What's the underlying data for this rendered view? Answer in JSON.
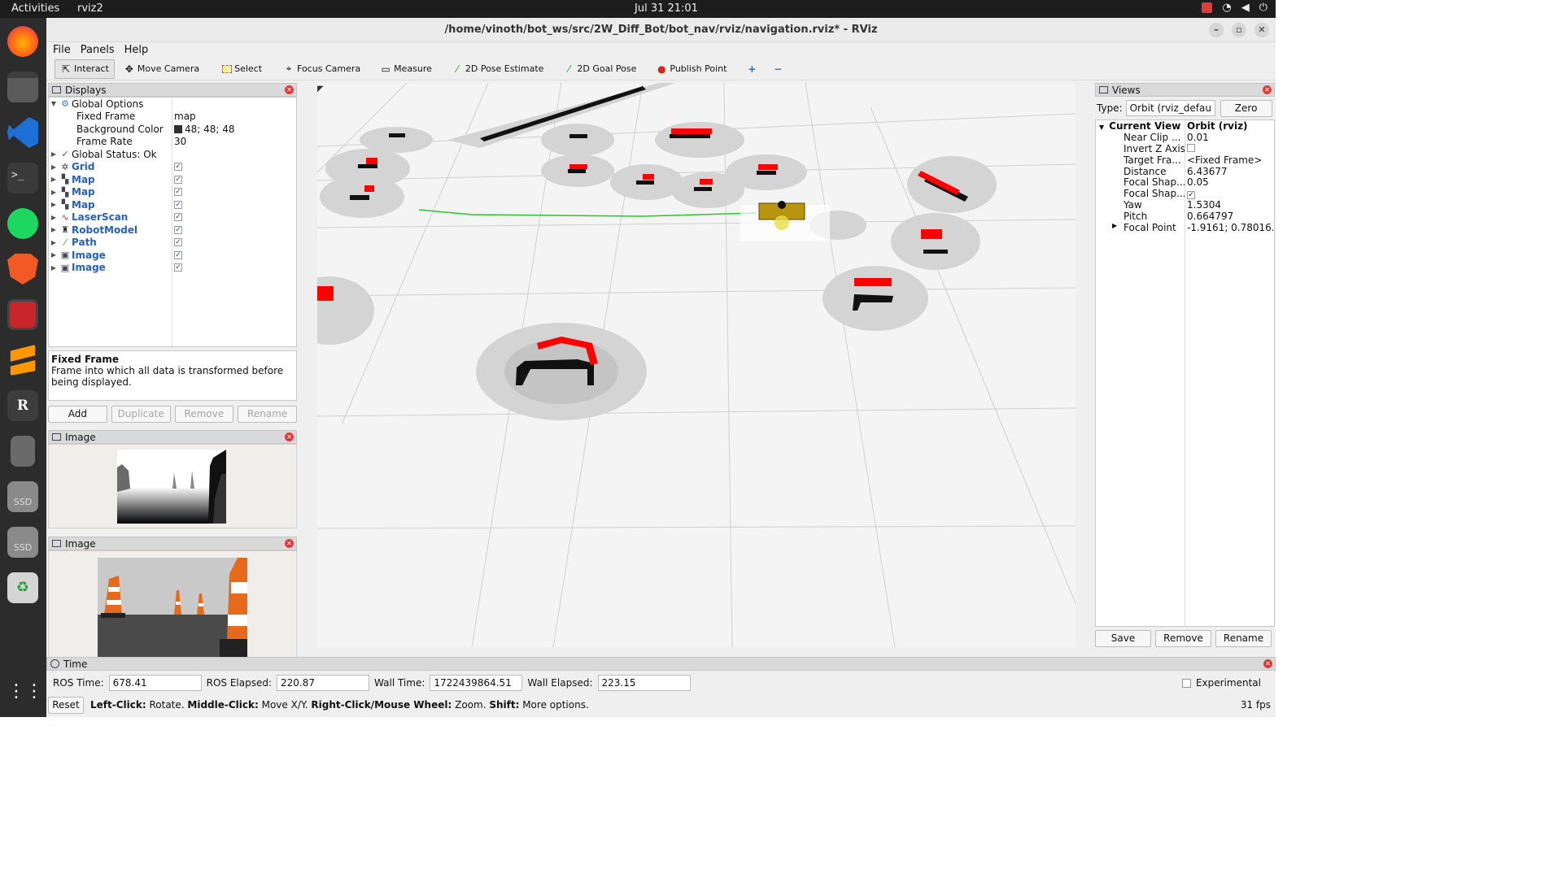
{
  "topbar": {
    "activities": "Activities",
    "app": "rviz2",
    "clock": "Jul 31  21:01"
  },
  "window": {
    "title": "/home/vinoth/bot_ws/src/2W_Diff_Bot/bot_nav/rviz/navigation.rviz* - RViz"
  },
  "menu": [
    "File",
    "Panels",
    "Help"
  ],
  "toolbar": [
    {
      "label": "Interact",
      "icon": "cursor-icon"
    },
    {
      "label": "Move Camera",
      "icon": "move-icon"
    },
    {
      "label": "Select",
      "icon": "select-icon"
    },
    {
      "label": "Focus Camera",
      "icon": "crosshair-icon"
    },
    {
      "label": "Measure",
      "icon": "ruler-icon"
    },
    {
      "label": "2D Pose Estimate",
      "icon": "arrow-icon"
    },
    {
      "label": "2D Goal Pose",
      "icon": "arrow-icon"
    },
    {
      "label": "Publish Point",
      "icon": "pin-icon"
    }
  ],
  "displays": {
    "title": "Displays",
    "global_options": "Global Options",
    "fixed_frame_label": "Fixed Frame",
    "fixed_frame": "map",
    "bg_label": "Background Color",
    "bg": "48; 48; 48",
    "rate_label": "Frame Rate",
    "rate": "30",
    "status": "Global Status: Ok",
    "items": [
      "Grid",
      "Map",
      "Map",
      "Map",
      "LaserScan",
      "RobotModel",
      "Path",
      "Image",
      "Image"
    ],
    "desc_title": "Fixed Frame",
    "desc_text": "Frame into which all data is transformed before being displayed.",
    "buttons": [
      "Add",
      "Duplicate",
      "Remove",
      "Rename"
    ]
  },
  "image1": {
    "title": "Image"
  },
  "image2": {
    "title": "Image"
  },
  "views": {
    "title": "Views",
    "type_label": "Type:",
    "type": "Orbit (rviz_defau",
    "zero": "Zero",
    "header_k": "Current View",
    "header_v": "Orbit (rviz)",
    "rows": [
      {
        "k": "Near Clip ...",
        "v": "0.01"
      },
      {
        "k": "Invert Z Axis",
        "v": ""
      },
      {
        "k": "Target Fra...",
        "v": "<Fixed Frame>"
      },
      {
        "k": "Distance",
        "v": "6.43677"
      },
      {
        "k": "Focal Shap...",
        "v": "0.05"
      },
      {
        "k": "Focal Shap...",
        "v": ""
      },
      {
        "k": "Yaw",
        "v": "1.5304"
      },
      {
        "k": "Pitch",
        "v": "0.664797"
      },
      {
        "k": "Focal Point",
        "v": "-1.9161; 0.78016..."
      }
    ],
    "buttons": [
      "Save",
      "Remove",
      "Rename"
    ]
  },
  "time": {
    "title": "Time",
    "ros_time_label": "ROS Time:",
    "ros_time": "678.41",
    "ros_elapsed_label": "ROS Elapsed:",
    "ros_elapsed": "220.87",
    "wall_time_label": "Wall Time:",
    "wall_time": "1722439864.51",
    "wall_elapsed_label": "Wall Elapsed:",
    "wall_elapsed": "223.15",
    "experimental": "Experimental"
  },
  "status": {
    "reset": "Reset",
    "b1": "Left-Click:",
    "t1": " Rotate. ",
    "b2": "Middle-Click:",
    "t2": " Move X/Y. ",
    "b3": "Right-Click/Mouse Wheel:",
    "t3": " Zoom. ",
    "b4": "Shift:",
    "t4": " More options.",
    "fps": "31 fps"
  },
  "colors": {
    "laser": "#ff0000",
    "path": "#22cc22",
    "robot": "#b8950e"
  }
}
